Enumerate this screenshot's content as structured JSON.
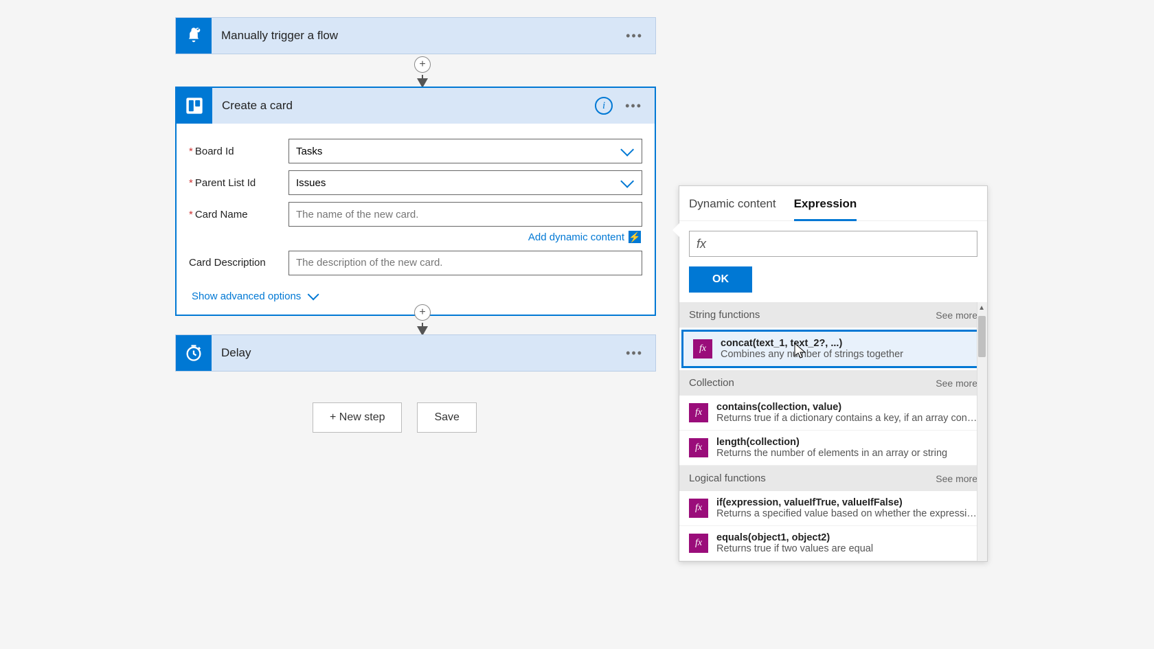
{
  "trigger": {
    "title": "Manually trigger a flow"
  },
  "createCard": {
    "title": "Create a card",
    "fields": {
      "board": {
        "label": "Board Id",
        "value": "Tasks"
      },
      "list": {
        "label": "Parent List Id",
        "value": "Issues"
      },
      "name": {
        "label": "Card Name",
        "placeholder": "The name of the new card."
      },
      "desc": {
        "label": "Card Description",
        "placeholder": "The description of the new card."
      }
    },
    "addDynamic": "Add dynamic content",
    "advancedToggle": "Show advanced options"
  },
  "delay": {
    "title": "Delay"
  },
  "buttons": {
    "newStep": "+ New step",
    "save": "Save"
  },
  "panel": {
    "tabs": {
      "dynamic": "Dynamic content",
      "expression": "Expression"
    },
    "fxLabel": "fx",
    "ok": "OK",
    "sections": {
      "string": {
        "label": "String functions",
        "seeMore": "See more"
      },
      "collection": {
        "label": "Collection",
        "seeMore": "See more"
      },
      "logical": {
        "label": "Logical functions",
        "seeMore": "See more"
      }
    },
    "fns": {
      "concat": {
        "sig": "concat(text_1, text_2?, ...)",
        "desc": "Combines any number of strings together"
      },
      "contains": {
        "sig": "contains(collection, value)",
        "desc": "Returns true if a dictionary contains a key, if an array cont..."
      },
      "length": {
        "sig": "length(collection)",
        "desc": "Returns the number of elements in an array or string"
      },
      "if": {
        "sig": "if(expression, valueIfTrue, valueIfFalse)",
        "desc": "Returns a specified value based on whether the expressio..."
      },
      "equals": {
        "sig": "equals(object1, object2)",
        "desc": "Returns true if two values are equal"
      }
    }
  }
}
